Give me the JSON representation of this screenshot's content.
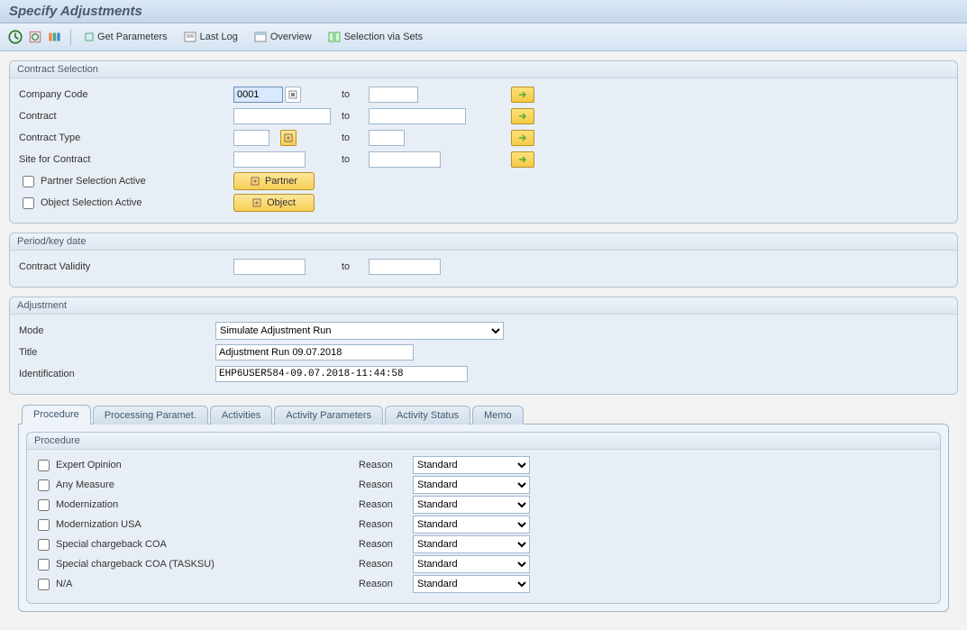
{
  "title": "Specify Adjustments",
  "toolbar": {
    "get_params": "Get Parameters",
    "last_log": "Last Log",
    "overview": "Overview",
    "sel_sets": "Selection via Sets"
  },
  "groups": {
    "contract_sel": {
      "title": "Contract Selection",
      "company_code_lbl": "Company Code",
      "company_code_val": "0001",
      "contract_lbl": "Contract",
      "contract_type_lbl": "Contract Type",
      "site_lbl": "Site for Contract",
      "to_lbl": "to",
      "partner_chk": "Partner Selection Active",
      "object_chk": "Object Selection Active",
      "partner_btn": "Partner",
      "object_btn": "Object"
    },
    "period": {
      "title": "Period/key date",
      "validity_lbl": "Contract Validity",
      "to_lbl": "to"
    },
    "adjust": {
      "title": "Adjustment",
      "mode_lbl": "Mode",
      "mode_val": "Simulate Adjustment Run",
      "title_lbl": "Title",
      "title_val": "Adjustment Run 09.07.2018",
      "ident_lbl": "Identification",
      "ident_val": "EHP6USER584-09.07.2018-11:44:58"
    }
  },
  "tabs": [
    "Procedure",
    "Processing Paramet.",
    "Activities",
    "Activity Parameters",
    "Activity Status",
    "Memo"
  ],
  "procedure": {
    "title": "Procedure",
    "reason_lbl": "Reason",
    "reason_val": "Standard",
    "items": [
      "Expert Opinion",
      "Any Measure",
      "Modernization",
      "Modernization USA",
      "Special chargeback COA",
      "Special chargeback COA (TASKSU)",
      "N/A"
    ]
  }
}
